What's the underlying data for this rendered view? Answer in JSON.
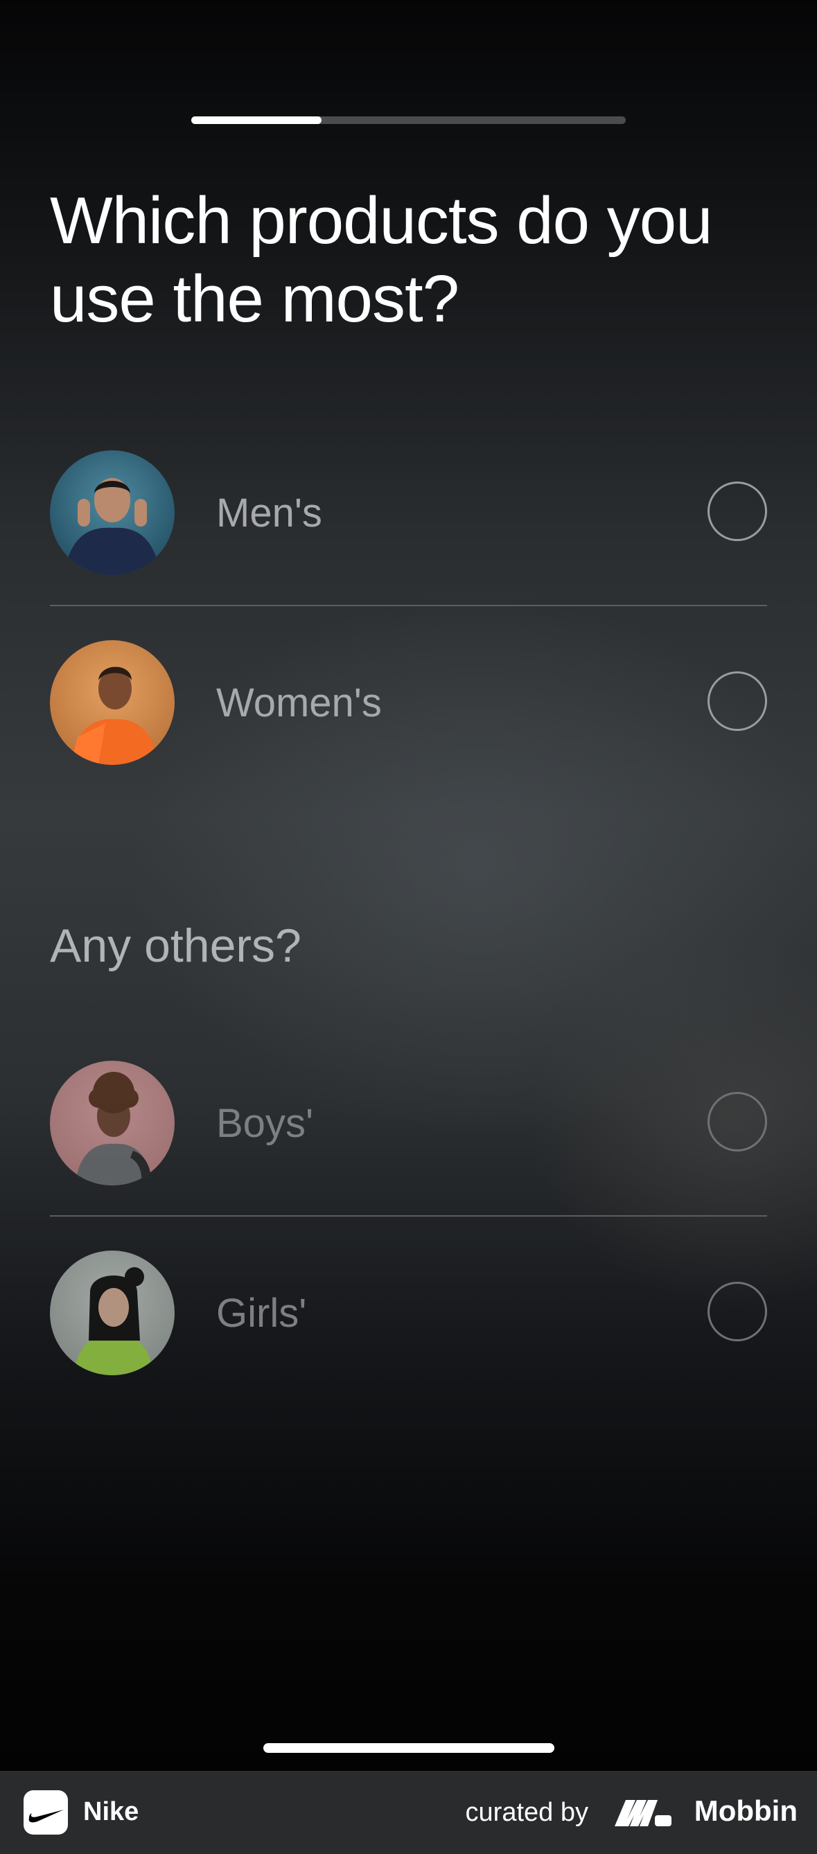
{
  "progress": {
    "value": 0.3
  },
  "question": {
    "title": "Which products do you use the most?"
  },
  "primary_options": [
    {
      "label": "Men's",
      "selected": false
    },
    {
      "label": "Women's",
      "selected": false
    }
  ],
  "secondary": {
    "heading": "Any others?",
    "options": [
      {
        "label": "Boys'",
        "selected": false
      },
      {
        "label": "Girls'",
        "selected": false
      }
    ]
  },
  "footer": {
    "app_name": "Nike",
    "curated_by": "curated by",
    "brand": "Mobbin",
    "app_icon": "nike-swoosh-icon",
    "brand_icon": "mobbin-logo-icon"
  },
  "colors": {
    "text_primary": "#ffffff",
    "text_secondary": "#a7a9ab",
    "radio_border": "#9a9c9e",
    "divider": "#5b5e61",
    "footer_bg": "#2a2b2d"
  }
}
